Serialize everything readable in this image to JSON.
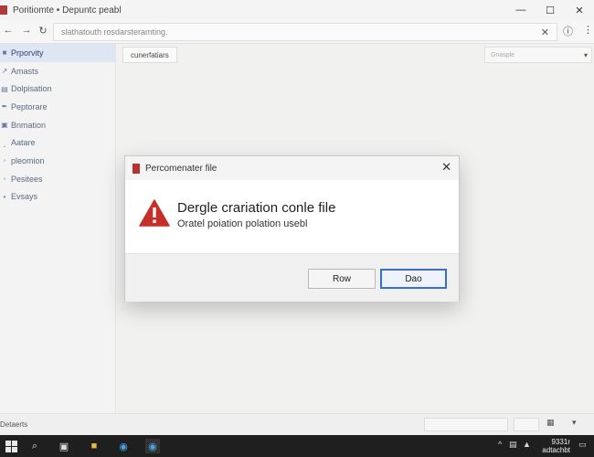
{
  "window": {
    "title": "Poritiomte • Depuntc peabl"
  },
  "address": {
    "url_text": "slathatouth  rosdarsteramting."
  },
  "sidebar": {
    "items": [
      {
        "label": "Prporvity",
        "icon": "■"
      },
      {
        "label": "Amasts",
        "icon": "↗"
      },
      {
        "label": "Dolpisation",
        "icon": "▤"
      },
      {
        "label": "Peptorare",
        "icon": "✒"
      },
      {
        "label": "Bnmation",
        "icon": "▣"
      },
      {
        "label": "Aatare",
        "icon": "‸"
      },
      {
        "label": "pleomion",
        "icon": "◦"
      },
      {
        "label": "Pesitees",
        "icon": "◦"
      },
      {
        "label": "Evsays",
        "icon": "•"
      }
    ]
  },
  "main": {
    "tab_label": "cunerfatiars",
    "dropdown_value": "Gnasple"
  },
  "status": {
    "left_text": "Detaerts"
  },
  "taskbar": {
    "clock_time": "9331r",
    "clock_date": "adtachbt"
  },
  "dialog": {
    "title": "Percomenater file",
    "message": "Dergle crariation conle file",
    "submessage": "Oratel poiation polation usebl",
    "button_secondary": "Row",
    "button_primary": "Dao"
  },
  "colors": {
    "accent": "#3a6fc4",
    "warning": "#c62f2a",
    "taskbar": "#1f1f1f"
  }
}
